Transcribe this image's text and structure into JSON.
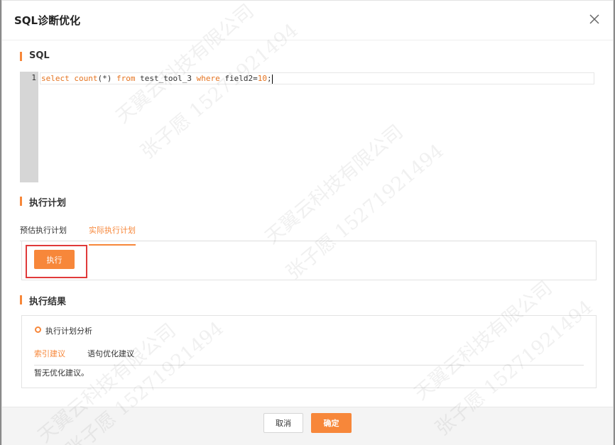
{
  "dialog": {
    "title": "SQL诊断优化",
    "close_icon": "close-icon"
  },
  "sql_section": {
    "title": "SQL",
    "line_number": "1",
    "code_tokens": [
      {
        "text": "select",
        "cls": "kw"
      },
      {
        "text": " ",
        "cls": "plain"
      },
      {
        "text": "count",
        "cls": "kw"
      },
      {
        "text": "(*) ",
        "cls": "plain"
      },
      {
        "text": "from",
        "cls": "kw"
      },
      {
        "text": " test_tool_3 ",
        "cls": "plain"
      },
      {
        "text": "where",
        "cls": "kw"
      },
      {
        "text": " field2=",
        "cls": "plain"
      },
      {
        "text": "10",
        "cls": "num"
      },
      {
        "text": ";",
        "cls": "plain"
      }
    ]
  },
  "plan_section": {
    "title": "执行计划",
    "tabs": [
      {
        "label": "预估执行计划",
        "active": false
      },
      {
        "label": "实际执行计划",
        "active": true
      }
    ],
    "execute_label": "执行"
  },
  "result_section": {
    "title": "执行结果",
    "analysis_label": "执行计划分析",
    "sub_tabs": [
      {
        "label": "索引建议",
        "active": true
      },
      {
        "label": "语句优化建议",
        "active": false
      }
    ],
    "empty_text": "暂无优化建议。"
  },
  "footer": {
    "cancel_label": "取消",
    "ok_label": "确定"
  },
  "watermark": {
    "company": "天翼云科技有限公司",
    "user": "张子愿 15271921494"
  },
  "colors": {
    "accent": "#f7873a",
    "highlight": "#e03a3a"
  }
}
